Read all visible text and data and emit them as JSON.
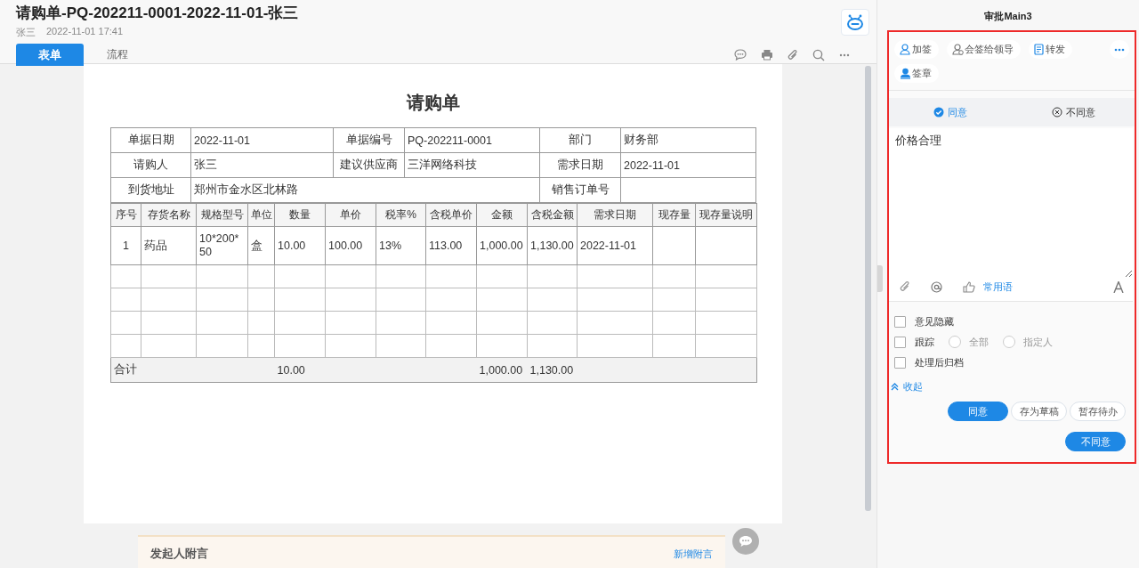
{
  "header": {
    "title": "请购单-PQ-202211-0001-2022-11-01-张三",
    "author": "张三",
    "time": "2022-11-01 17:41"
  },
  "tabs": [
    {
      "label": "表单",
      "selected": true
    },
    {
      "label": "流程",
      "selected": false
    }
  ],
  "document": {
    "title": "请购单",
    "info_rows": [
      [
        {
          "label": "单据日期",
          "value": "2022-11-01"
        },
        {
          "label": "单据编号",
          "value": "PQ-202211-0001"
        },
        {
          "label": "部门",
          "value": "财务部"
        }
      ],
      [
        {
          "label": "请购人",
          "value": "张三"
        },
        {
          "label": "建议供应商",
          "value": "三洋网络科技"
        },
        {
          "label": "需求日期",
          "value": "2022-11-01"
        }
      ],
      [
        {
          "label": "到货地址",
          "value": "郑州市金水区北林路",
          "wide": true
        },
        {
          "label": "销售订单号"
        }
      ]
    ],
    "columns": [
      "序号",
      "存货名称",
      "规格型号",
      "单位",
      "数量",
      "单价",
      "税率%",
      "含税单价",
      "金额",
      "含税金额",
      "需求日期",
      "现存量",
      "现存量说明"
    ],
    "rows": [
      [
        "1",
        "药品",
        "10*200*50",
        "盒",
        "10.00",
        "100.00",
        "13%",
        "113.00",
        "1,000.00",
        "1,130.00",
        "2022-11-01",
        null,
        null
      ]
    ],
    "totals": {
      "label": "合计",
      "cells": [
        "10.00",
        null,
        null,
        null,
        "1,000.00",
        "1,130.00",
        null,
        null,
        null
      ]
    }
  },
  "footer": {
    "title": "发起人附言",
    "link": "新增附言"
  },
  "panel": {
    "title": "审批Main3",
    "actions": [
      {
        "label": "加签",
        "kind": "person"
      },
      {
        "label": "会签给领导",
        "kind": "people"
      },
      {
        "label": "转发",
        "kind": "forward"
      },
      {
        "label": "签章",
        "kind": "seal"
      }
    ],
    "opinion_tabs": [
      {
        "label": "同意",
        "selected": true
      },
      {
        "label": "不同意",
        "selected": false
      }
    ],
    "comment": "价格合理",
    "phrases_link": "常用语",
    "options": [
      {
        "label": "意见隐藏",
        "checked": false
      },
      {
        "label": "跟踪",
        "checked": false,
        "radios": [
          {
            "label": "全部",
            "selected": false
          },
          {
            "label": "指定人",
            "selected": false
          }
        ]
      },
      {
        "label": "处理后归档",
        "checked": false
      }
    ],
    "collapse": "收起",
    "buttons": [
      {
        "label": "同意",
        "kind": "primary"
      },
      {
        "label": "存为草稿",
        "kind": "default"
      },
      {
        "label": "暂存待办",
        "kind": "default"
      },
      {
        "label": "不同意",
        "kind": "primary"
      }
    ]
  }
}
